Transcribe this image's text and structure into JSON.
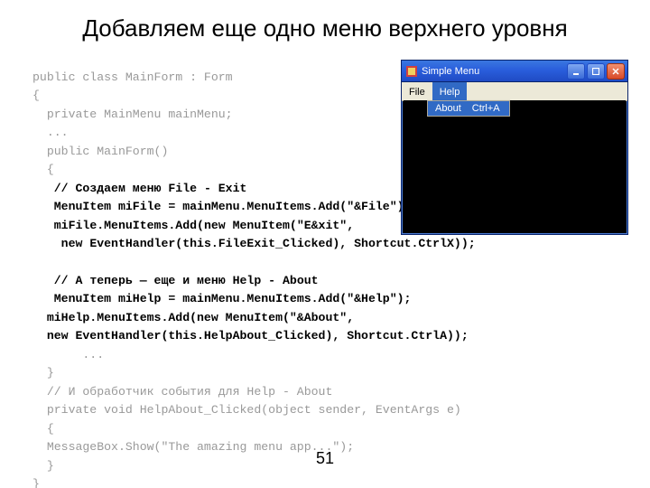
{
  "title": "Добавляем еще одно меню верхнего уровня",
  "page_number": "51",
  "code": {
    "l1": "public class MainForm : Form",
    "l2": "{",
    "l3": "  private MainMenu mainMenu;",
    "l4": "  ...",
    "l5": "  public MainForm()",
    "l6": "  {",
    "l7a": "   ",
    "l7b": "// Создаем меню File - Exit",
    "l8a": "   ",
    "l8b": "MenuItem miFile = mainMenu.MenuItems.Add(\"&File\");",
    "l9a": "   ",
    "l9b": "miFile.MenuItems.Add(new MenuItem(\"E&xit\",",
    "l10a": "   ",
    "l10b": " new EventHandler(this.FileExit_Clicked), Shortcut.CtrlX));",
    "l11": "",
    "l12a": "   ",
    "l12b": "// А теперь — еще и меню Help - About",
    "l13a": "   ",
    "l13b": "MenuItem miHelp = mainMenu.MenuItems.Add(\"&Help\");",
    "l14a": "  ",
    "l14b": "miHelp.MenuItems.Add(new MenuItem(\"&About\",",
    "l15a": "  ",
    "l15b": "new EventHandler(this.HelpAbout_Clicked), Shortcut.CtrlA));",
    "l16": "       ...",
    "l17": "  }",
    "l18": "  // И обработчик события для Help - About",
    "l19": "  private void HelpAbout_Clicked(object sender, EventArgs e)",
    "l20": "  {",
    "l21": "  MessageBox.Show(\"The amazing menu app...\");",
    "l22": "  }",
    "l23": "}"
  },
  "window": {
    "title": "Simple Menu",
    "menu_file": "File",
    "menu_help": "Help",
    "dropdown_label": "About",
    "dropdown_shortcut": "Ctrl+A"
  }
}
